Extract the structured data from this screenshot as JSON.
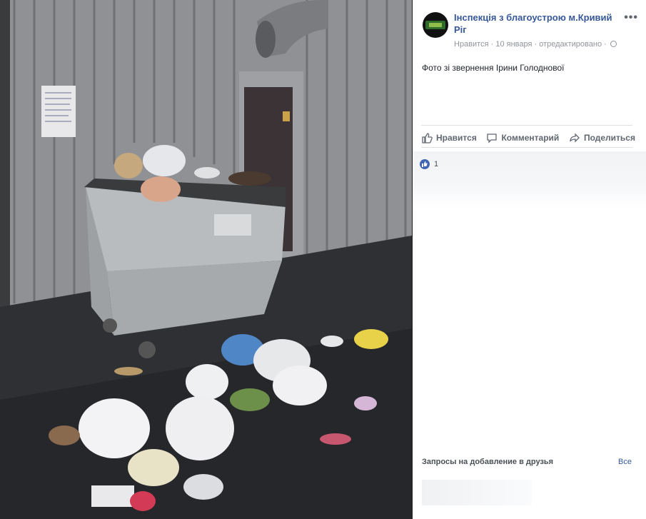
{
  "post": {
    "page_name": "Інспекція з благоустрою м.Кривий Ріг",
    "meta_like": "Нравится",
    "meta_date": "10 января",
    "meta_edited": "отредактировано",
    "separator": " · ",
    "more_label": "•••",
    "text": "Фото зі звернення Ірини Голоднової"
  },
  "actions": {
    "like": "Нравится",
    "comment": "Комментарий",
    "share": "Поделиться"
  },
  "reactions": {
    "count": "1"
  },
  "friends": {
    "title": "Запросы на добавление в друзья",
    "see_all": "Все"
  },
  "colors": {
    "link": "#365899",
    "like_blue": "#4267b2",
    "muted": "#90949c"
  }
}
